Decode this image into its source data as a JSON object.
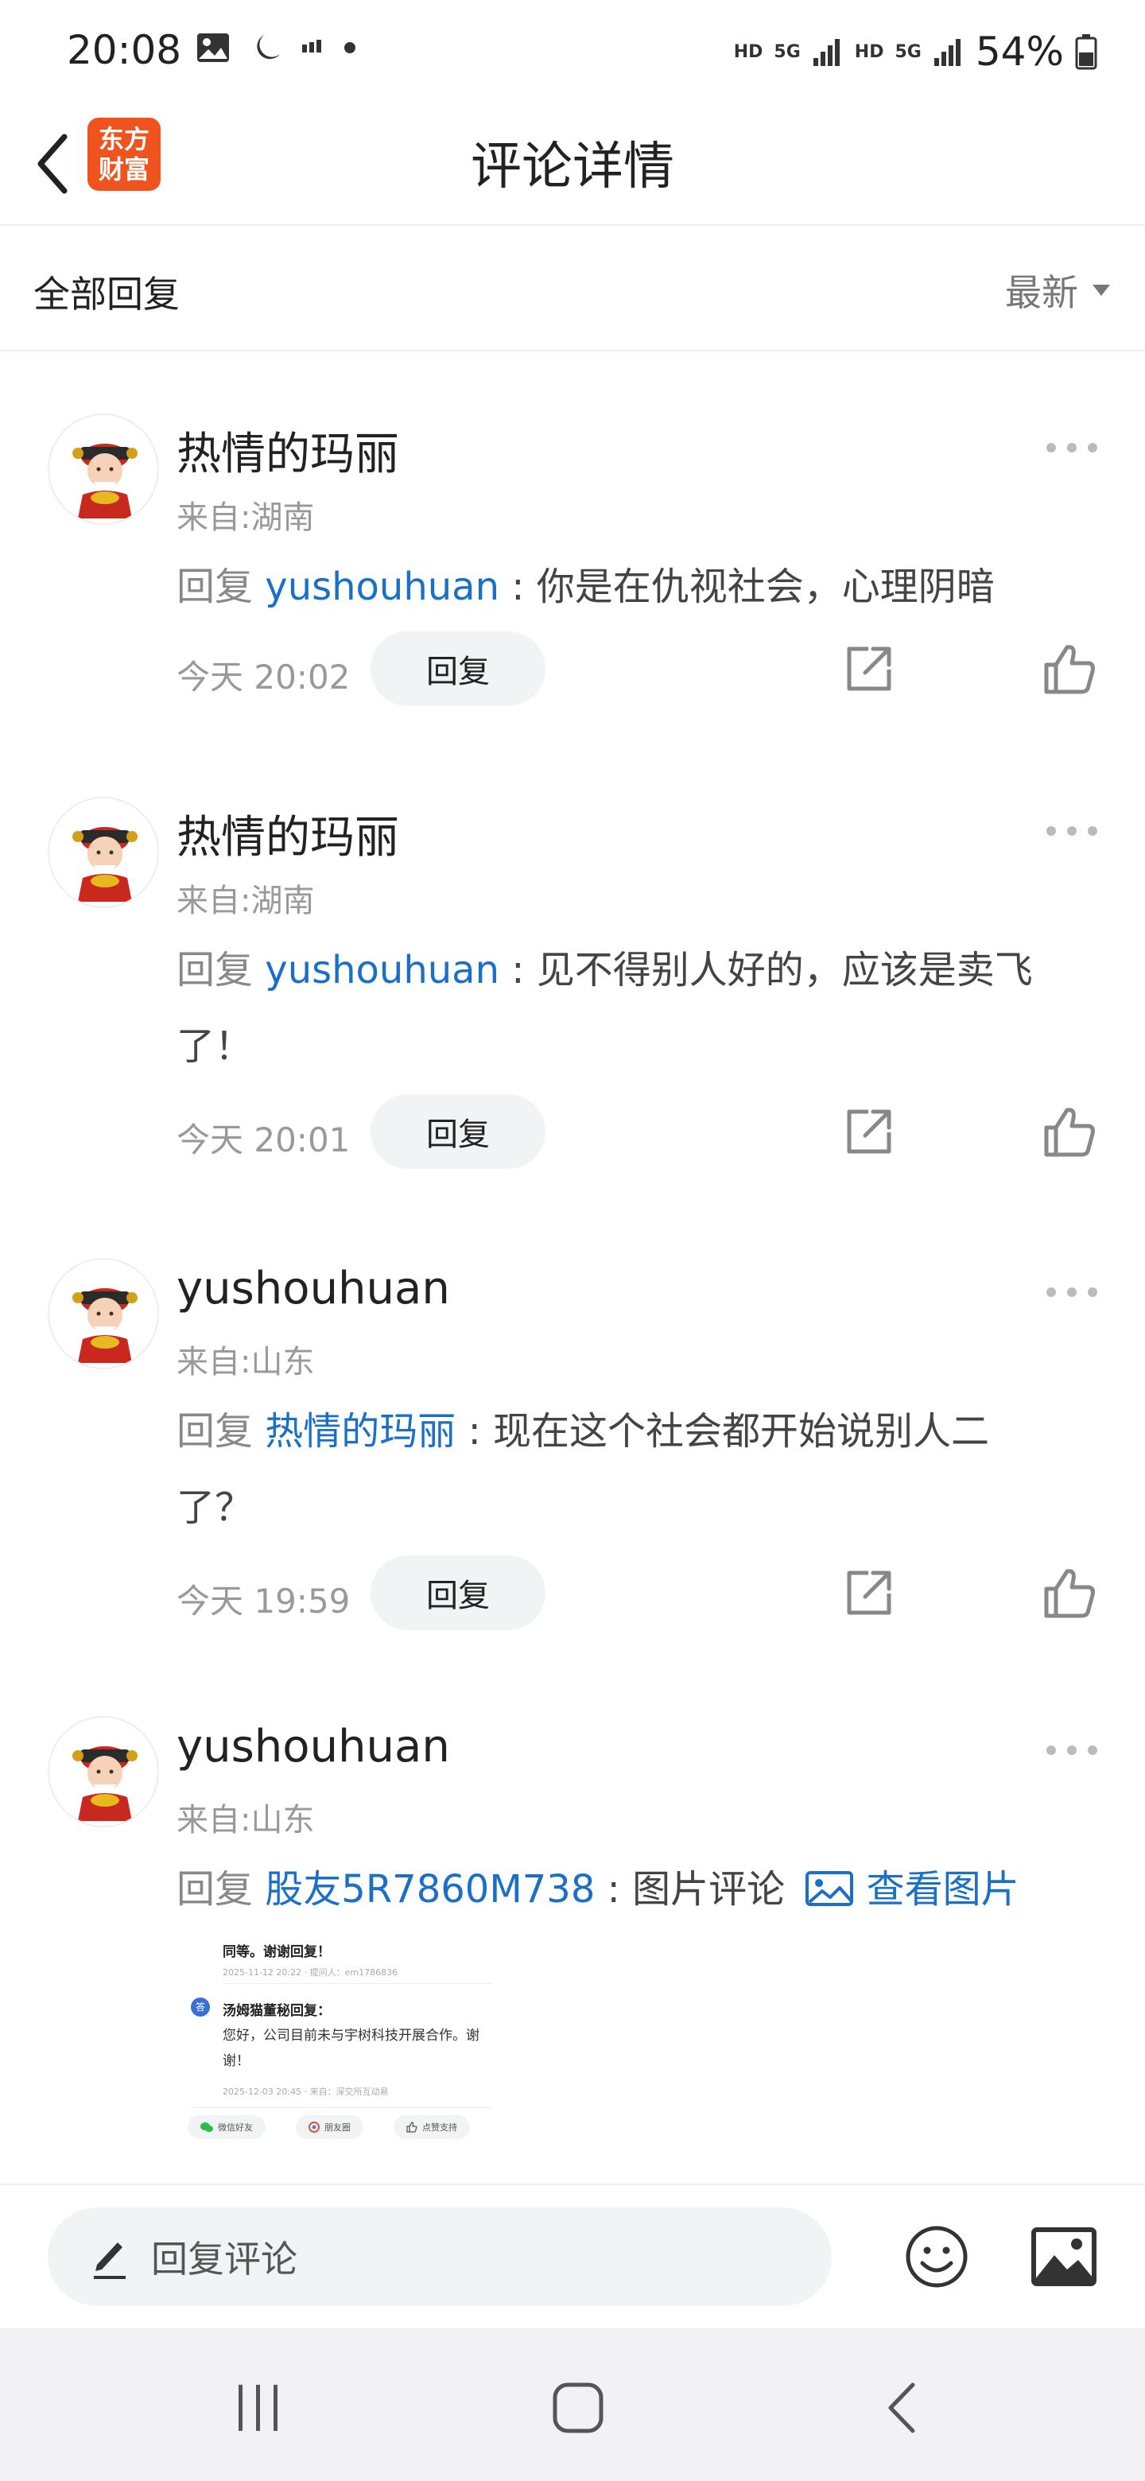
{
  "status_bar": {
    "time": "20:08",
    "net1": "HD",
    "net1_gen": "5G",
    "net2": "HD",
    "net2_gen": "5G",
    "battery": "54%"
  },
  "header": {
    "title": "评论详情",
    "logo_line1": "东方",
    "logo_line2": "财富",
    "logo_color": "#f0541e"
  },
  "sort_bar": {
    "title": "全部回复",
    "selected": "最新"
  },
  "comments": [
    {
      "user": "热情的玛丽",
      "location": "来自:湖南",
      "reply_prefix": "回复",
      "reply_target": "yushouhuan",
      "separator": ":",
      "text": "你是在仇视社会，心理阴暗",
      "time": "今天 20:02",
      "reply_label": "回复"
    },
    {
      "user": "热情的玛丽",
      "location": "来自:湖南",
      "reply_prefix": "回复",
      "reply_target": "yushouhuan",
      "separator": ":",
      "text": "见不得别人好的，应该是卖飞了！",
      "time": "今天 20:01",
      "reply_label": "回复"
    },
    {
      "user": "yushouhuan",
      "location": "来自:山东",
      "reply_prefix": "回复",
      "reply_target": "热情的玛丽",
      "separator": ":",
      "text": "现在这个社会都开始说别人二了？",
      "time": "今天 19:59",
      "reply_label": "回复"
    },
    {
      "user": "yushouhuan",
      "location": "来自:山东",
      "reply_prefix": "回复",
      "reply_target": "股友5R7860M738",
      "separator": ":",
      "text": "图片评论",
      "view_image": "查看图片",
      "image": {
        "line1": "同等。谢谢回复！",
        "line1_meta": "2025-11-12 20:22 · 提问人：em1786836",
        "badge": "答",
        "reply_title": "汤姆猫董秘回复：",
        "reply_body": "您好，公司目前未与宇树科技开展合作。谢谢！",
        "reply_meta": "2025-12-03 20:45 · 来自：深交所互动易",
        "chip1": "微信好友",
        "chip2": "朋友圈",
        "chip3": "点赞支持"
      }
    }
  ],
  "input_bar": {
    "placeholder": "回复评论"
  },
  "colors": {
    "link": "#1a6fc9",
    "muted": "#999999"
  }
}
